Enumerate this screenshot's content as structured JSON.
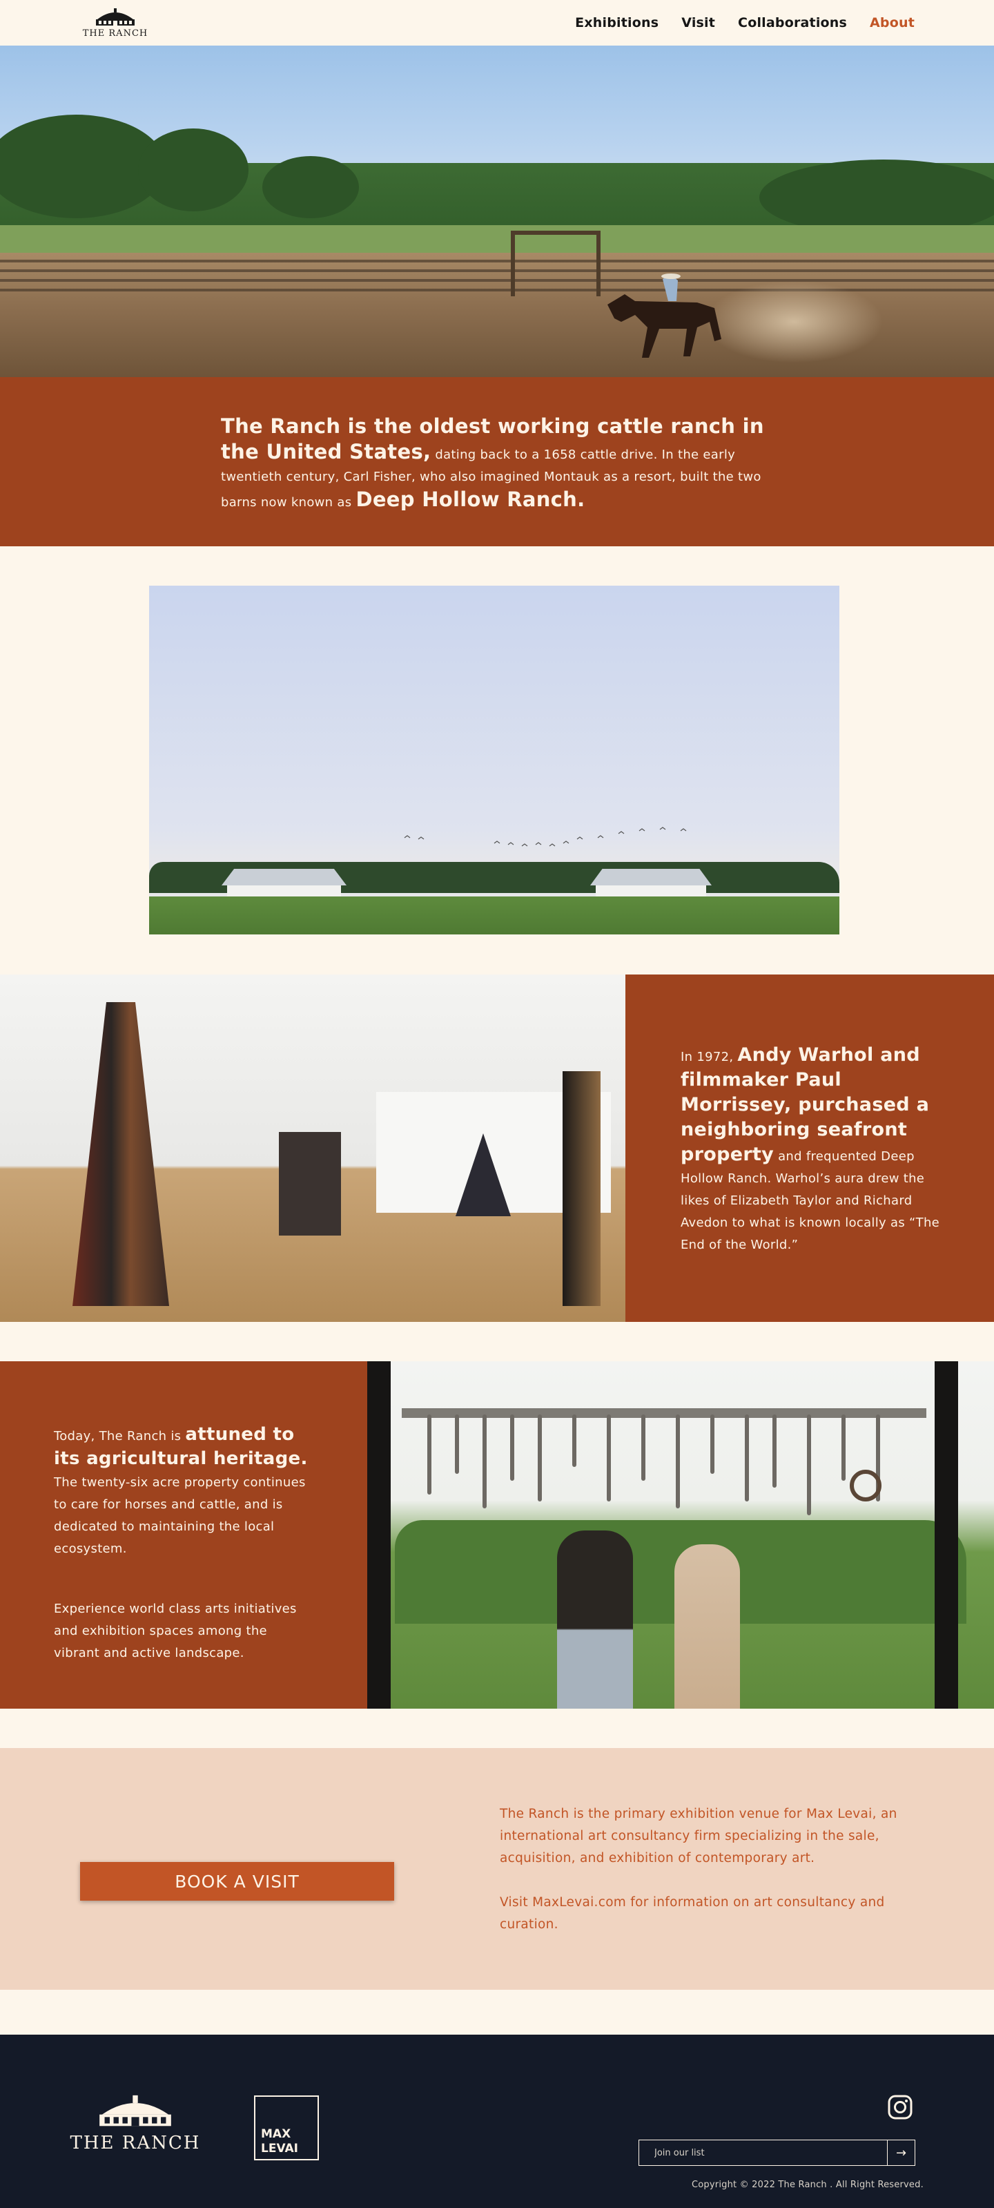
{
  "header": {
    "logo_text": "THE RANCH",
    "nav": [
      {
        "label": "Exhibitions"
      },
      {
        "label": "Visit"
      },
      {
        "label": "Collaborations"
      },
      {
        "label": "About"
      }
    ],
    "active_color": "#c25526"
  },
  "intro": {
    "lead": "The Ranch is the oldest working cattle ranch in the United States,",
    "body": " dating back to a 1658 cattle drive.  In the early twentieth century, Carl Fisher, who also imagined Montauk as a resort, built the two barns now known as ",
    "highlight": "Deep Hollow Ranch."
  },
  "warhol": {
    "pre": "In 1972, ",
    "highlight": "Andy Warhol and filmmaker Paul Morrissey, purchased a neighboring seafront property",
    "body": " and  frequented Deep Hollow Ranch. Warhol’s aura drew the likes of Elizabeth Taylor and Richard Avedon to what is known locally as “The End of the World.”"
  },
  "today": {
    "pre": "Today, The Ranch is ",
    "highlight": "attuned to its agricultural heritage.",
    "body": "The twenty-six acre property continues to care for horses and cattle, and is dedicated to maintaining the local ecosystem.",
    "para2": "Experience world class arts initiatives and exhibition spaces among the vibrant and active landscape."
  },
  "visit": {
    "button_label": "BOOK A VISIT",
    "info1": "The Ranch is the primary exhibition venue for Max Levai, an international art consultancy firm specializing in the sale, acquisition, and exhibition of contemporary art.",
    "info2": "Visit MaxLevai.com for information on art consultancy and curation."
  },
  "footer": {
    "logo_text": "THE RANCH",
    "partner_line1": "MAX",
    "partner_line2": "LEVAI",
    "newsletter_placeholder": "Join our list",
    "submit_icon": "arrow-right-icon",
    "social_icon": "instagram-icon",
    "copyright": "Copyright © 2022 The Ranch . All Right Reserved.",
    "bg_color": "#141a28"
  },
  "colors": {
    "rust": "#9e431e",
    "orange": "#c25526",
    "cream": "#fdf6eb",
    "peach": "#f0d4c1"
  }
}
